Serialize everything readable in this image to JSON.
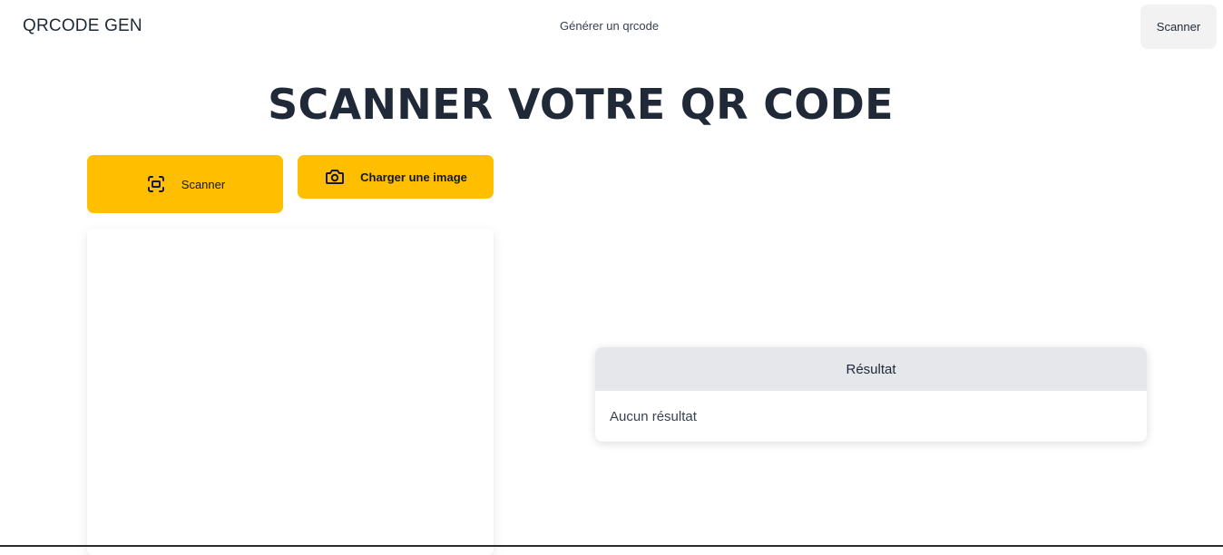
{
  "navbar": {
    "brand": "QRCODE GEN",
    "link_generate": "Générer un qrcode",
    "scan_button": "Scanner"
  },
  "main": {
    "title": "SCANNER VOTRE QR CODE",
    "scan_button": "Scanner",
    "scan_icon": "scan-frame-icon",
    "upload_button": "Charger une image",
    "upload_icon": "camera-icon"
  },
  "result": {
    "header": "Résultat",
    "value": "Aucun résultat"
  },
  "colors": {
    "accent": "#ffbf00",
    "header_bg": "#e5e7eb",
    "text": "#1f2937"
  }
}
